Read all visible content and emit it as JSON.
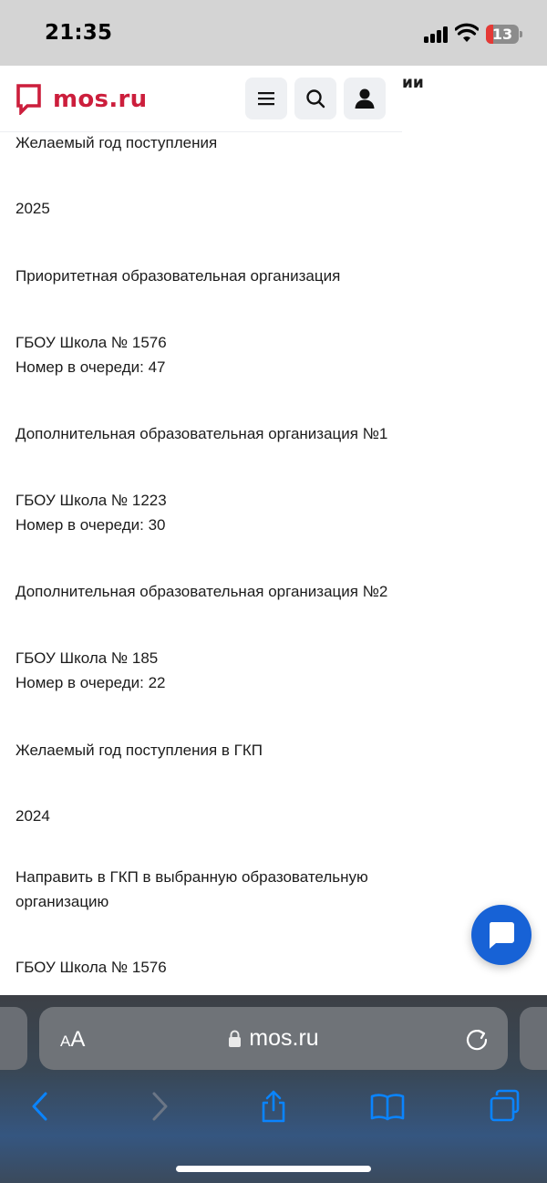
{
  "status_bar": {
    "time": "21:35",
    "battery_level": "13",
    "icons": [
      "signal-icon",
      "wifi-icon",
      "battery-icon"
    ]
  },
  "header": {
    "logo_text": "mos.ru",
    "cut_title": "ии",
    "buttons": [
      "menu-icon",
      "search-icon",
      "profile-icon"
    ],
    "brand_color": "#cc1e3c"
  },
  "content": {
    "desired_year_label": "Желаемый год поступления",
    "desired_year_value": "2025",
    "priority_org_label": "Приоритетная образовательная организация",
    "priority_org_name": "ГБОУ Школа № 1576",
    "priority_org_queue": "Номер в очереди: 47",
    "additional_org_1_label": "Дополнительная образовательная организация №1",
    "additional_org_1_name": "ГБОУ Школа № 1223",
    "additional_org_1_queue": "Номер в очереди: 30",
    "additional_org_2_label": "Дополнительная образовательная организация №2",
    "additional_org_2_name": "ГБОУ Школа № 185",
    "additional_org_2_queue": "Номер в очереди: 22",
    "gkp_year_label": "Желаемый год поступления в ГКП",
    "gkp_year_value": "2024",
    "gkp_direction_label_line1": "Направить в ГКП в выбранную образовательную",
    "gkp_direction_label_line2": "организацию",
    "gkp_direction_value": "ГБОУ Школа № 1576"
  },
  "chat_button": {
    "icon": "chat-icon",
    "color": "#1762d6"
  },
  "browser": {
    "aa_small": "A",
    "aa_big": "A",
    "url": "mos.ru",
    "icons": [
      "lock-icon",
      "reload-icon",
      "back-icon",
      "forward-icon",
      "share-icon",
      "bookmarks-icon",
      "tabs-icon"
    ],
    "accent": "#0a84ff"
  }
}
